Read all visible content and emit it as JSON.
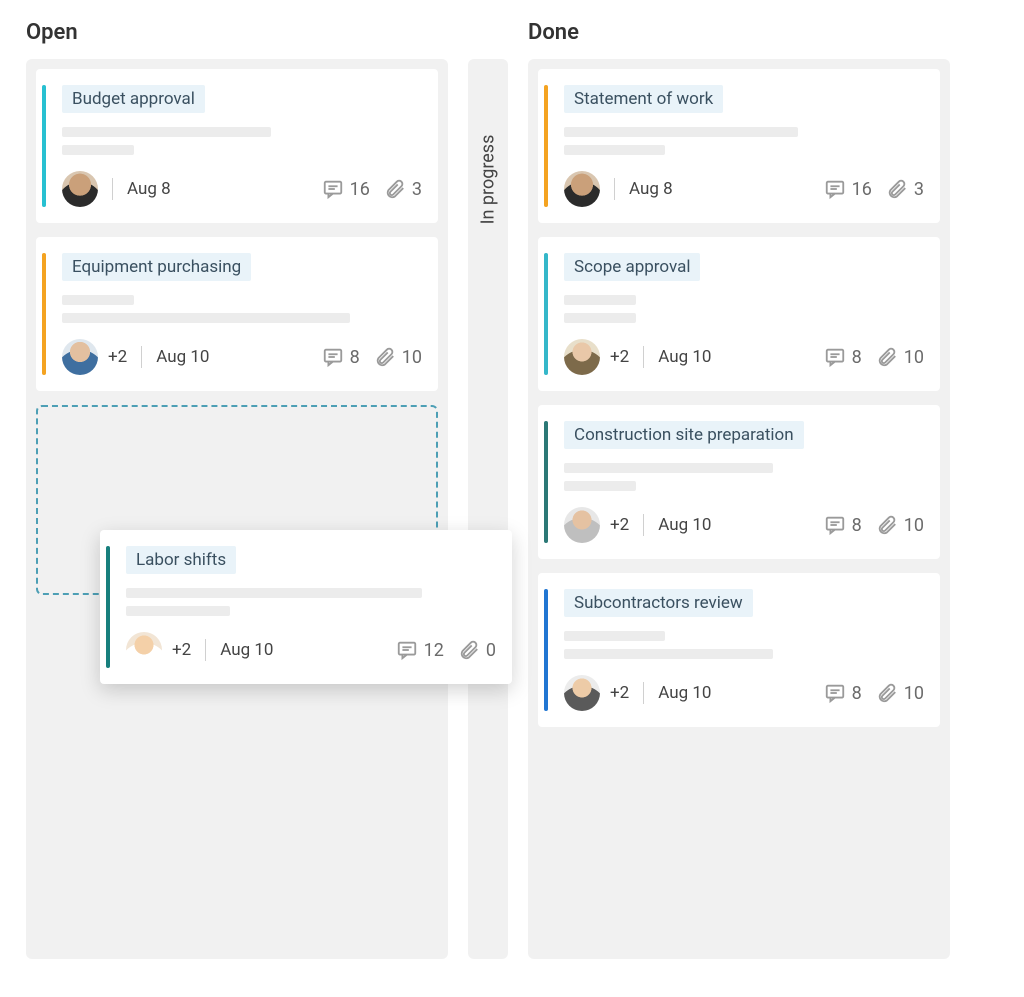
{
  "colors": {
    "stripe_cyan": "#27c0d1",
    "stripe_orange": "#f4a321",
    "stripe_teal": "#177f7d",
    "stripe_light_teal": "#35b7c9",
    "stripe_dark_teal": "#2b7876",
    "stripe_blue": "#2176d2"
  },
  "columns": {
    "open": {
      "title": "Open",
      "cards": [
        {
          "title": "Budget approval",
          "stripe": "#27c0d1",
          "date": "Aug 8",
          "extra": "",
          "comments": 16,
          "attachments": 3,
          "avatar": "av1",
          "ph": [
            "w58",
            "w20"
          ]
        },
        {
          "title": "Equipment purchasing",
          "stripe": "#f4a321",
          "date": "Aug 10",
          "extra": "+2",
          "comments": 8,
          "attachments": 10,
          "avatar": "av2",
          "ph": [
            "w20",
            "w80"
          ]
        }
      ]
    },
    "in_progress": {
      "title": "In progress"
    },
    "done": {
      "title": "Done",
      "cards": [
        {
          "title": "Statement of work",
          "stripe": "#f4a321",
          "date": "Aug 8",
          "extra": "",
          "comments": 16,
          "attachments": 3,
          "avatar": "av1",
          "ph": [
            "w65",
            "w28"
          ]
        },
        {
          "title": "Scope approval",
          "stripe": "#35b7c9",
          "date": "Aug 10",
          "extra": "+2",
          "comments": 8,
          "attachments": 10,
          "avatar": "av3",
          "ph": [
            "w20",
            "w20"
          ]
        },
        {
          "title": "Construction site preparation",
          "stripe": "#2b7876",
          "date": "Aug 10",
          "extra": "+2",
          "comments": 8,
          "attachments": 10,
          "avatar": "av4",
          "ph": [
            "w58",
            "w20"
          ]
        },
        {
          "title": "Subcontractors review",
          "stripe": "#2176d2",
          "date": "Aug 10",
          "extra": "+2",
          "comments": 8,
          "attachments": 10,
          "avatar": "av5",
          "ph": [
            "w28",
            "w58"
          ]
        }
      ]
    }
  },
  "dragging": {
    "title": "Labor shifts",
    "stripe": "#177f7d",
    "date": "Aug 10",
    "extra": "+2",
    "comments": 12,
    "attachments": 0,
    "avatar": "av6",
    "ph": [
      "w80",
      "w28"
    ]
  }
}
